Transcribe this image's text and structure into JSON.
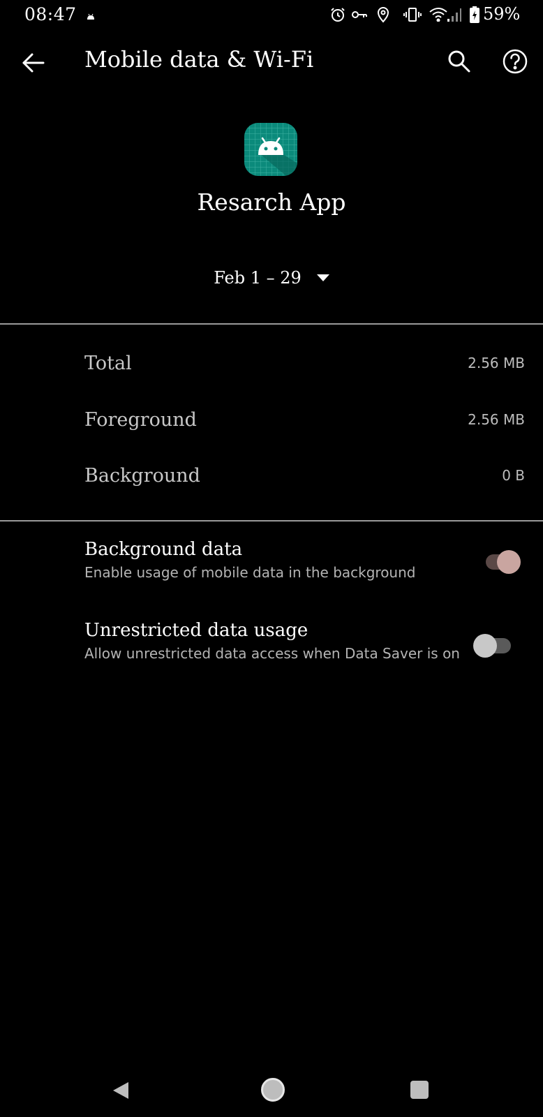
{
  "status_bar": {
    "time": "08:47",
    "battery": "59%",
    "icons": [
      "android-notification-icon",
      "alarm-icon",
      "vpn-key-icon",
      "location-icon",
      "vibrate-icon",
      "wifi-icon",
      "signal-icon",
      "battery-icon"
    ]
  },
  "app_bar": {
    "title": "Mobile data & Wi-Fi",
    "back_icon": "arrow-back-icon",
    "search_icon": "search-icon",
    "help_icon": "help-icon"
  },
  "app": {
    "name": "Resarch App",
    "icon": "android-app-icon",
    "icon_color": "#0b8a7b"
  },
  "date_range": {
    "label": "Feb 1 – 29",
    "dropdown_icon": "dropdown-arrow-icon"
  },
  "usage": [
    {
      "label": "Total",
      "value": "2.56 MB"
    },
    {
      "label": "Foreground",
      "value": "2.56 MB"
    },
    {
      "label": "Background",
      "value": "0 B"
    }
  ],
  "settings": [
    {
      "title": "Background data",
      "summary": "Enable usage of mobile data in the background",
      "enabled": true
    },
    {
      "title": "Unrestricted data usage",
      "summary": "Allow unrestricted data access when Data Saver is on",
      "enabled": false
    }
  ],
  "colors": {
    "background": "#000000",
    "toggle_on_thumb": "#c9a5a0",
    "toggle_on_track": "#5a4846",
    "toggle_off_thumb": "#c8c8c8",
    "toggle_off_track": "#5a5a5a"
  },
  "nav_bar": {
    "back": "nav-back-icon",
    "home": "nav-home-icon",
    "recents": "nav-recents-icon"
  }
}
